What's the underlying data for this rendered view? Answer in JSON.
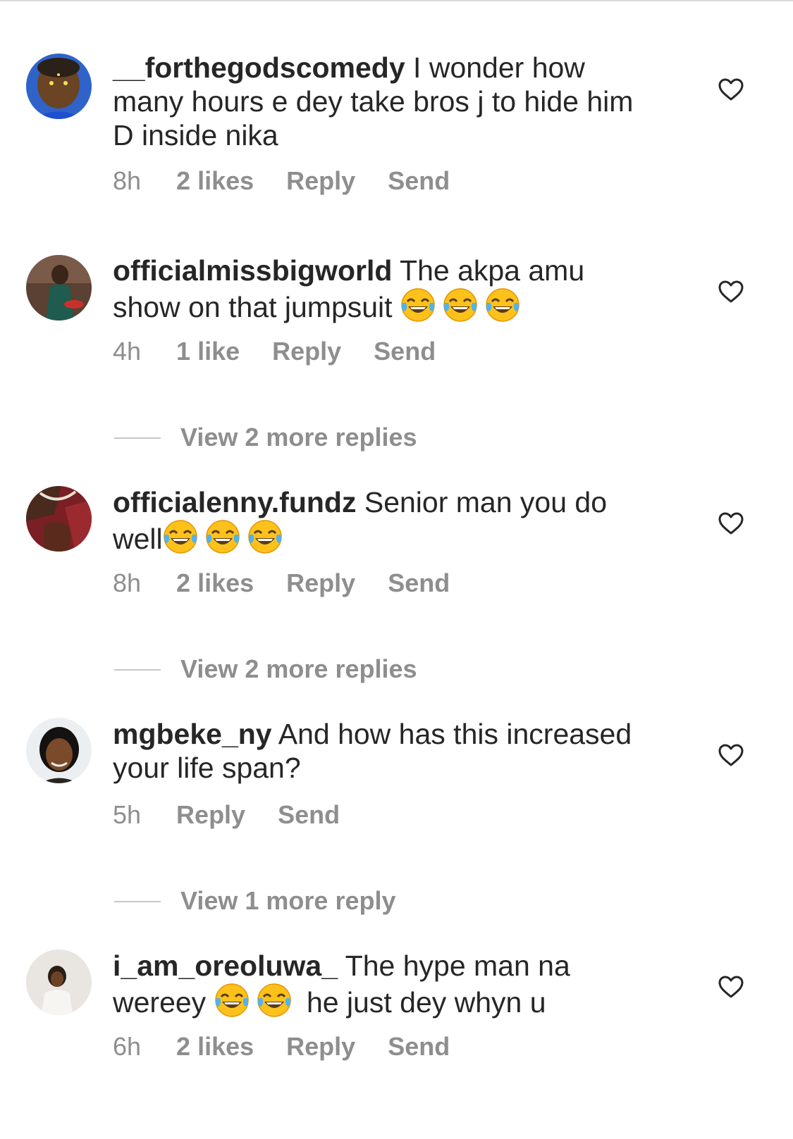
{
  "comments": [
    {
      "username": "__forthegodscomedy",
      "text_line1": " I wonder how",
      "text_line2": "many hours e dey take bros j to hide him",
      "text_line3": "D inside nika",
      "time": "8h",
      "likes": "2 likes",
      "reply": "Reply",
      "send": "Send"
    },
    {
      "username": "officialmissbigworld",
      "text_line1": " The akpa amu",
      "text_line2": "show on that jumpsuit ",
      "emoji": [
        "face-with-tears-of-joy",
        "face-with-tears-of-joy",
        "face-with-tears-of-joy"
      ],
      "time": "4h",
      "likes": "1 like",
      "reply": "Reply",
      "send": "Send",
      "view_replies": "View 2 more replies"
    },
    {
      "username": "officialenny.fundz",
      "text_line1": " Senior man you do",
      "text_line2": "well",
      "emoji": [
        "face-with-tears-of-joy",
        "face-with-tears-of-joy",
        "face-with-tears-of-joy"
      ],
      "time": "8h",
      "likes": "2 likes",
      "reply": "Reply",
      "send": "Send",
      "view_replies": "View 2 more replies"
    },
    {
      "username": "mgbeke_ny",
      "text_line1": " And how has this increased",
      "text_line2": "your life span?",
      "time": "5h",
      "reply": "Reply",
      "send": "Send",
      "view_replies": "View 1 more reply"
    },
    {
      "username": "i_am_oreoluwa_",
      "text_line1": " The hype man na",
      "text_line2a": "wereey ",
      "text_line2b": " he just dey whyn u",
      "emoji": [
        "face-with-tears-of-joy",
        "face-with-tears-of-joy"
      ],
      "time": "6h",
      "likes": "2 likes",
      "reply": "Reply",
      "send": "Send"
    }
  ],
  "icons": {
    "like": "heart-outline-icon",
    "emoji": "face-with-tears-of-joy"
  },
  "colors": {
    "text": "#262626",
    "meta": "#8e8e8e",
    "separator": "#dbdbdb"
  }
}
